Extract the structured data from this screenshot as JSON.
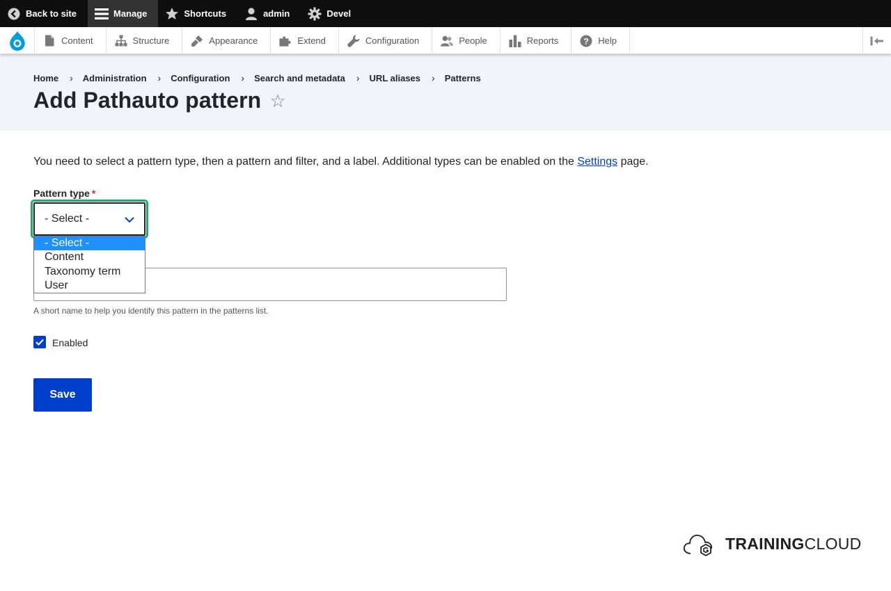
{
  "toolbar": {
    "back_to_site": "Back to site",
    "manage": "Manage",
    "shortcuts": "Shortcuts",
    "user": "admin",
    "devel": "Devel"
  },
  "tray": {
    "items": [
      {
        "label": "Content",
        "icon": "file-icon"
      },
      {
        "label": "Structure",
        "icon": "sitemap-icon"
      },
      {
        "label": "Appearance",
        "icon": "brush-icon"
      },
      {
        "label": "Extend",
        "icon": "puzzle-icon"
      },
      {
        "label": "Configuration",
        "icon": "wrench-icon"
      },
      {
        "label": "People",
        "icon": "people-icon"
      },
      {
        "label": "Reports",
        "icon": "bar-chart-icon"
      },
      {
        "label": "Help",
        "icon": "help-icon"
      }
    ]
  },
  "breadcrumb": [
    "Home",
    "Administration",
    "Configuration",
    "Search and metadata",
    "URL aliases",
    "Patterns"
  ],
  "page": {
    "title": "Add Pathauto pattern",
    "intro_before": "You need to select a pattern type, then a pattern and filter, and a label. Additional types can be enabled on the ",
    "intro_link": "Settings",
    "intro_after": " page."
  },
  "form": {
    "pattern_type_label": "Pattern type",
    "required_mark": "*",
    "pattern_type_value": "- Select -",
    "pattern_type_options": [
      "- Select -",
      "Content",
      "Taxonomy term",
      "User"
    ],
    "label_description": "A short name to help you identify this pattern in the patterns list.",
    "enabled_label": "Enabled",
    "enabled_checked": true,
    "save_label": "Save"
  },
  "brand": {
    "bold": "TRAINING",
    "light": "CLOUD"
  },
  "colors": {
    "primary": "#003ecc",
    "focus": "#26a769",
    "toolbar": "#0f0f0f",
    "header_bg": "#f3f4f9"
  }
}
